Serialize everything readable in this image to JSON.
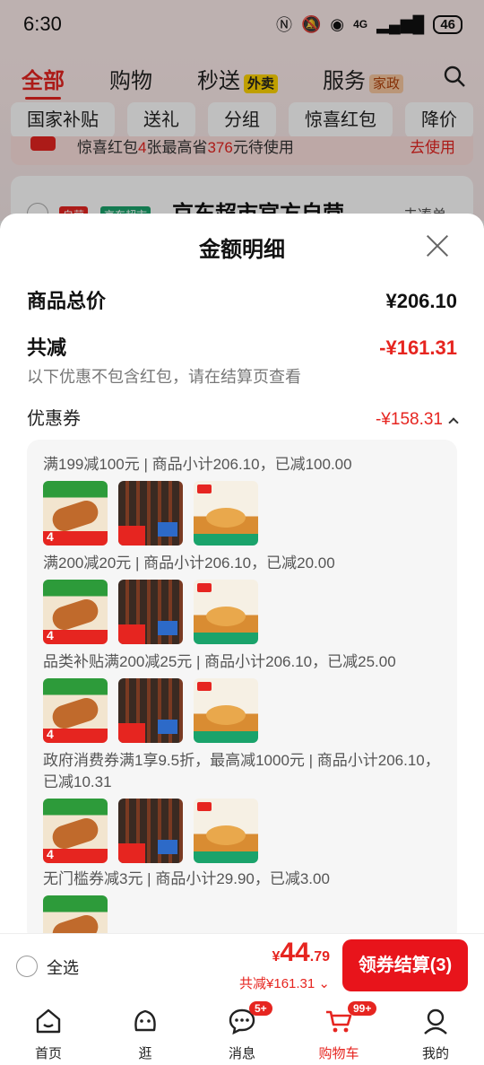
{
  "status_bar": {
    "time": "6:30",
    "network": "4G",
    "battery": "46"
  },
  "top_tabs": [
    {
      "label": "全部",
      "active": true
    },
    {
      "label": "购物"
    },
    {
      "label": "秒送",
      "tag": "外卖"
    },
    {
      "label": "服务",
      "tag": "家政"
    }
  ],
  "chips": [
    "国家补贴",
    "送礼",
    "分组",
    "惊喜红包",
    "降价"
  ],
  "red_packet_bar": {
    "text_pre": "惊喜红包",
    "count": "4",
    "text_mid": "张最高省",
    "amount": "376",
    "text_post": "元待使用",
    "action": "去使用"
  },
  "shop": {
    "self_tag": "自营",
    "channel_tag": "京东超市",
    "name": "京东超市官方自营",
    "more": "去凑单"
  },
  "sheet": {
    "title": "金额明细",
    "total_label": "商品总价",
    "total_value": "¥206.10",
    "discount_label": "共减",
    "discount_value": "-¥161.31",
    "discount_note": "以下优惠不包含红包，请在结算页查看",
    "coupon_label": "优惠券",
    "coupon_value": "-¥158.31",
    "groups": [
      {
        "desc": "满199减100元 | 商品小计206.10，已减100.00"
      },
      {
        "desc": "满200减20元 | 商品小计206.10，已减20.00"
      },
      {
        "desc": "品类补贴满200减25元 | 商品小计206.10，已减25.00"
      },
      {
        "desc": "政府消费券满1享9.5折，最高减1000元 | 商品小计206.10，已减10.31"
      },
      {
        "desc": "无门槛券减3元 | 商品小计29.90，已减3.00"
      }
    ]
  },
  "checkout": {
    "select_all": "全选",
    "currency": "¥",
    "price_int": "44",
    "price_dec": ".79",
    "saved": "共减¥161.31",
    "button": "领券结算(3)"
  },
  "nav": [
    {
      "label": "首页",
      "icon": "home-icon"
    },
    {
      "label": "逛",
      "icon": "browse-icon"
    },
    {
      "label": "消息",
      "icon": "message-icon",
      "badge": "5+"
    },
    {
      "label": "购物车",
      "icon": "cart-icon",
      "badge": "99+",
      "active": true
    },
    {
      "label": "我的",
      "icon": "profile-icon"
    }
  ],
  "colors": {
    "accent": "#e62520",
    "button": "#e8141b"
  }
}
